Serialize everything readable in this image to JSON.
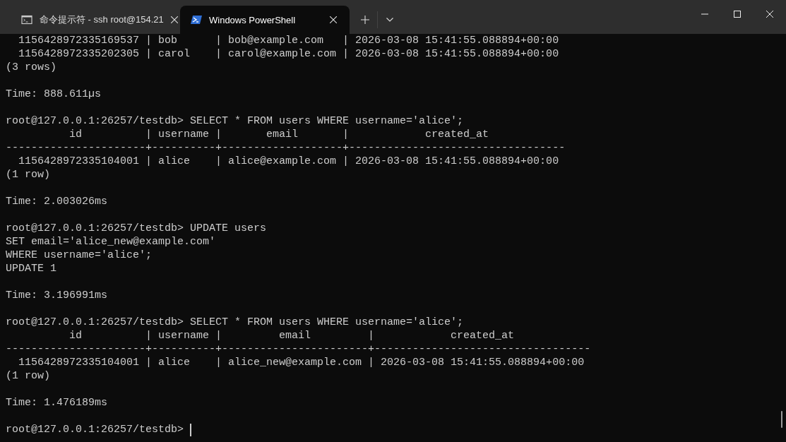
{
  "tabs": [
    {
      "kind": "cmd",
      "title": "命令提示符 - ssh  root@154.21",
      "selected": false
    },
    {
      "kind": "powershell",
      "title": "Windows PowerShell",
      "selected": true
    }
  ],
  "terminal": {
    "blocks": [
      [
        "  1156428972335169537 | bob      | bob@example.com   | 2026-03-08 15:41:55.088894+00:00",
        "  1156428972335202305 | carol    | carol@example.com | 2026-03-08 15:41:55.088894+00:00",
        "(3 rows)"
      ],
      [
        "Time: 888.611µs"
      ],
      [
        "root@127.0.0.1:26257/testdb> SELECT * FROM users WHERE username='alice';",
        "          id          | username |       email       |            created_at",
        "----------------------+----------+-------------------+----------------------------------",
        "  1156428972335104001 | alice    | alice@example.com | 2026-03-08 15:41:55.088894+00:00",
        "(1 row)"
      ],
      [
        "Time: 2.003026ms"
      ],
      [
        "root@127.0.0.1:26257/testdb> UPDATE users",
        "SET email='alice_new@example.com'",
        "WHERE username='alice';",
        "UPDATE 1"
      ],
      [
        "Time: 3.196991ms"
      ],
      [
        "root@127.0.0.1:26257/testdb> SELECT * FROM users WHERE username='alice';",
        "          id          | username |         email         |            created_at",
        "----------------------+----------+-----------------------+----------------------------------",
        "  1156428972335104001 | alice    | alice_new@example.com | 2026-03-08 15:41:55.088894+00:00",
        "(1 row)"
      ],
      [
        "Time: 1.476189ms"
      ]
    ],
    "prompt": "root@127.0.0.1:26257/testdb> "
  }
}
